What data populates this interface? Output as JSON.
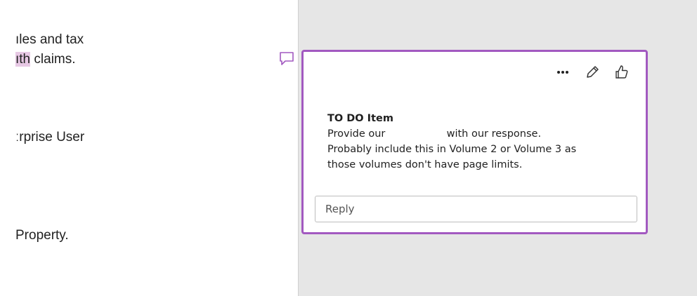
{
  "document": {
    "lines": [
      {
        "before": "ıles and tax",
        "highlight": "",
        "after": ""
      },
      {
        "before": "",
        "highlight": "ıth",
        "after": " claims."
      },
      {
        "before": "ːrprise User",
        "highlight": "",
        "after": ""
      },
      {
        "before": " Property.",
        "highlight": "",
        "after": ""
      }
    ]
  },
  "comment": {
    "toolbar": {
      "more_label": "···",
      "more_icon": "more-options-icon",
      "edit_icon": "pencil-icon",
      "like_icon": "thumbs-up-icon"
    },
    "title": "TO DO Item",
    "line1_before": "Provide our ",
    "line1_after": " with our response.",
    "line2": "Probably include this in Volume 2 or Volume 3 as",
    "line3": "those volumes don't have page limits.",
    "reply_placeholder": "Reply"
  },
  "colors": {
    "accent": "#a259c0",
    "highlight": "#e7c8e4",
    "margin_bg": "#e6e6e6"
  }
}
